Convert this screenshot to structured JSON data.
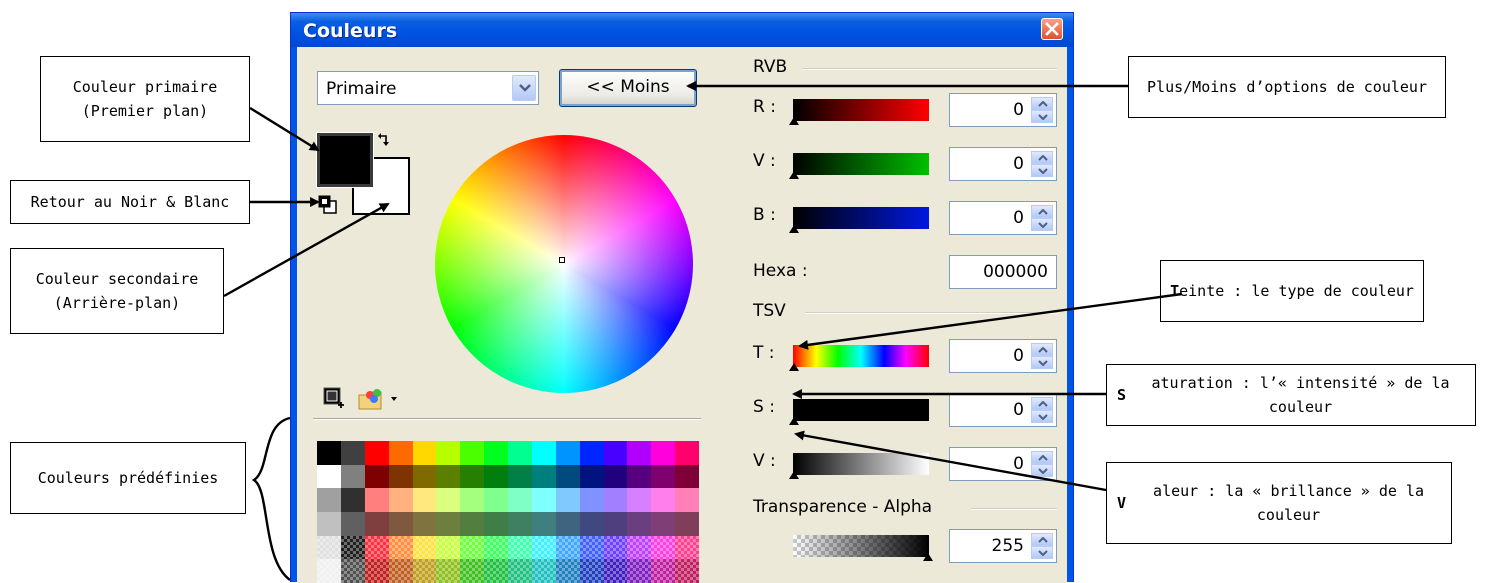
{
  "window": {
    "title": "Couleurs",
    "close_icon": "close-icon"
  },
  "mode_select": {
    "value": "Primaire"
  },
  "toggle_button": {
    "label": "<< Moins"
  },
  "rvb": {
    "label": "RVB",
    "r_label": "R :",
    "v_label": "V :",
    "b_label": "B :",
    "r_value": "0",
    "v_value": "0",
    "b_value": "0",
    "hexa_label": "Hexa :",
    "hexa_value": "000000"
  },
  "tsv": {
    "label": "TSV",
    "t_label": "T :",
    "s_label": "S :",
    "v_label": "V :",
    "t_value": "0",
    "s_value": "0",
    "v_value": "0"
  },
  "alpha": {
    "label": "Transparence - Alpha",
    "value": "255"
  },
  "colors": {
    "primary": "#000000",
    "secondary": "#ffffff",
    "titlebar": "#0054e3",
    "dialog_bg": "#ece9d8"
  },
  "palette": [
    [
      "#000000",
      "#404040",
      "#ff0000",
      "#ff6a00",
      "#ffd800",
      "#b6ff00",
      "#4cff00",
      "#00ff21",
      "#00ff90",
      "#00ffff",
      "#0094ff",
      "#0026ff",
      "#4800ff",
      "#b200ff",
      "#ff00dc",
      "#ff006e"
    ],
    [
      "#ffffff",
      "#808080",
      "#7f0000",
      "#7f3300",
      "#7f6a00",
      "#5b7f00",
      "#267f00",
      "#007f0e",
      "#007f46",
      "#007f7f",
      "#004a7f",
      "#00137f",
      "#21007f",
      "#57007f",
      "#7f006e",
      "#7f0037"
    ],
    [
      "#a0a0a0",
      "#303030",
      "#ff7f7f",
      "#ffb27f",
      "#ffe97f",
      "#daff7f",
      "#a5ff7f",
      "#7fff8e",
      "#7fffc5",
      "#7fffff",
      "#7fc9ff",
      "#7f92ff",
      "#a17fff",
      "#d67fff",
      "#ff7fed",
      "#ff7fb6"
    ],
    [
      "#c0c0c0",
      "#606060",
      "#7f3f3f",
      "#7f593f",
      "#7f743f",
      "#6d7f3f",
      "#527f3f",
      "#3f7f47",
      "#3f7f62",
      "#3f7f7f",
      "#3f647f",
      "#3f497f",
      "#503f7f",
      "#6b3f7f",
      "#7f3f76",
      "#7f3f5b"
    ],
    [
      "#e0e0e0",
      "#202020",
      "#ff3040",
      "#ff8f3f",
      "#ffe240",
      "#c8ff40",
      "#70ff40",
      "#40ff60",
      "#40ffb0",
      "#40f0ff",
      "#40a8ff",
      "#4060ff",
      "#7040ff",
      "#c040ff",
      "#ff40e0",
      "#ff4090"
    ],
    [
      "#f0f0f0",
      "#505050",
      "#c02020",
      "#c06020",
      "#c0a020",
      "#90c020",
      "#40c020",
      "#20c040",
      "#20c080",
      "#20c0c0",
      "#2080c0",
      "#2040c0",
      "#4020c0",
      "#8020c0",
      "#c020a0",
      "#c02060"
    ]
  ],
  "callouts": {
    "primary": [
      "Couleur primaire",
      "(Premier plan)"
    ],
    "reset": "Retour au Noir & Blanc",
    "secondary": [
      "Couleur secondaire",
      "(Arrière-plan)"
    ],
    "predefined": "Couleurs prédéfinies",
    "more_less": "Plus/Moins d’options de couleur",
    "hue": {
      "bold": "T",
      "rest": "einte : le type de couleur"
    },
    "saturation": {
      "bold": "S",
      "rest": "aturation : l’« intensité » de la couleur"
    },
    "value": {
      "bold": "V",
      "rest": "aleur : la « brillance » de la couleur"
    }
  }
}
